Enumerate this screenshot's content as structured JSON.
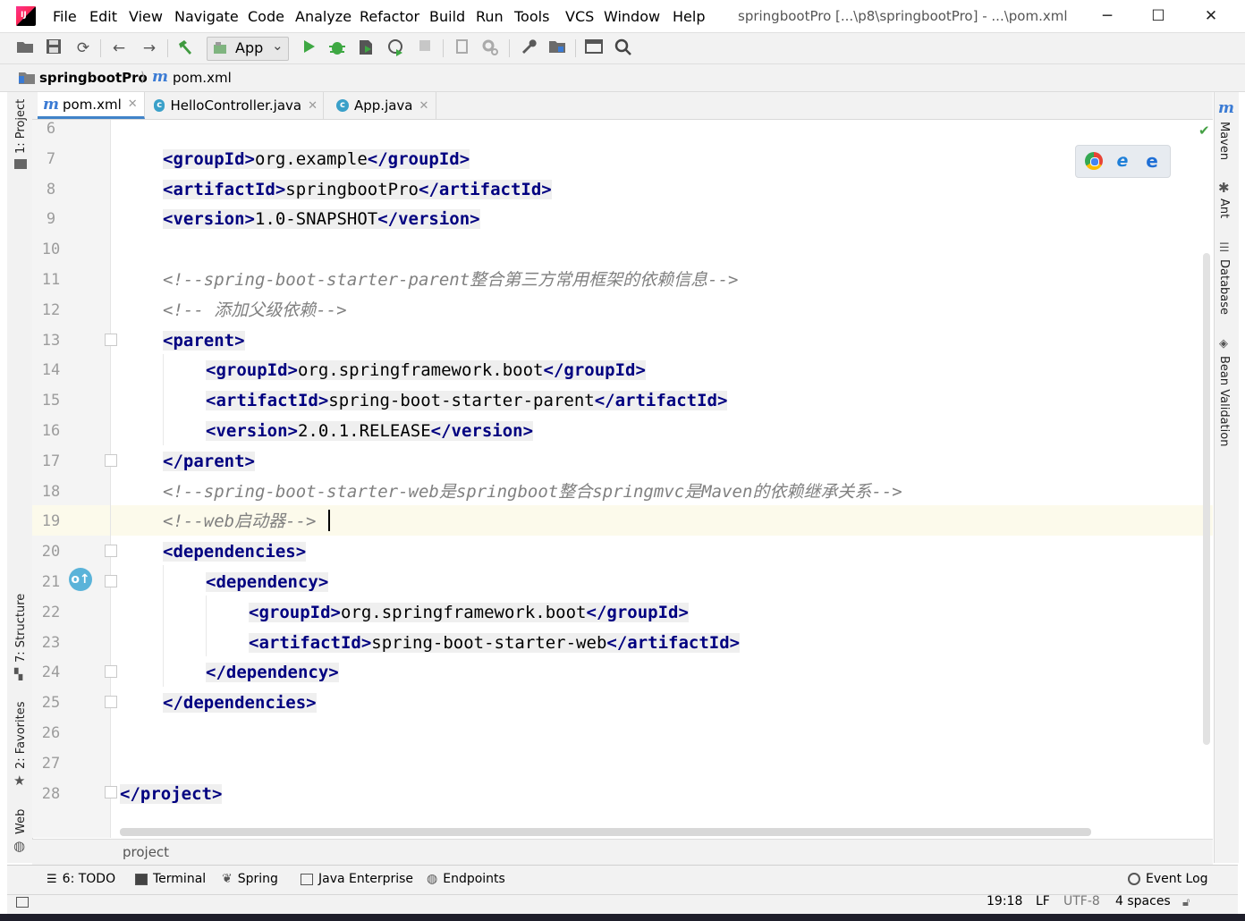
{
  "menu": [
    "File",
    "Edit",
    "View",
    "Navigate",
    "Code",
    "Analyze",
    "Refactor",
    "Build",
    "Run",
    "Tools",
    "VCS",
    "Window",
    "Help"
  ],
  "window_title": "springbootPro [...\\p8\\springbootPro] - ...\\pom.xml",
  "window_controls": {
    "minimize": "─",
    "maximize": "☐",
    "close": "✕"
  },
  "toolbar": {
    "run_config": "App",
    "run_config_arrow": "⌄"
  },
  "breadcrumb": {
    "project": "springbootPro",
    "sep": "⟩",
    "file": "pom.xml"
  },
  "tabs": [
    {
      "label": "pom.xml",
      "icon": "maven-file-icon"
    },
    {
      "label": "HelloController.java",
      "icon": "class-icon"
    },
    {
      "label": "App.java",
      "icon": "class-icon"
    }
  ],
  "left_tools": {
    "project": "1: Project",
    "structure": "7: Structure",
    "favorites": "2: Favorites",
    "web": "Web"
  },
  "right_tools": {
    "maven": "Maven",
    "ant": "Ant",
    "database": "Database",
    "bean_validation": "Bean Validation"
  },
  "editor": {
    "lines": [
      {
        "n": "6"
      },
      {
        "n": "7",
        "parts": [
          [
            "tg",
            "<groupId>"
          ],
          [
            "br",
            "org.example"
          ],
          [
            "tg",
            "</groupId>"
          ]
        ]
      },
      {
        "n": "8",
        "parts": [
          [
            "tg",
            "<artifactId>"
          ],
          [
            "br",
            "springbootPro"
          ],
          [
            "tg",
            "</artifactId>"
          ]
        ]
      },
      {
        "n": "9",
        "parts": [
          [
            "tg",
            "<version>"
          ],
          [
            "br",
            "1.0-SNAPSHOT"
          ],
          [
            "tg",
            "</version>"
          ]
        ]
      },
      {
        "n": "10"
      },
      {
        "n": "11",
        "comment": "<!--spring-boot-starter-parent整合第三方常用框架的依赖信息-->"
      },
      {
        "n": "12",
        "comment": "<!-- 添加父级依赖-->"
      },
      {
        "n": "13",
        "parts": [
          [
            "tg",
            "<parent>"
          ]
        ]
      },
      {
        "n": "14",
        "parts": [
          [
            "tg",
            "<groupId>"
          ],
          [
            "br",
            "org.springframework.boot"
          ],
          [
            "tg",
            "</groupId>"
          ]
        ]
      },
      {
        "n": "15",
        "parts": [
          [
            "tg",
            "<artifactId>"
          ],
          [
            "br",
            "spring-boot-starter-parent"
          ],
          [
            "tg",
            "</artifactId>"
          ]
        ]
      },
      {
        "n": "16",
        "parts": [
          [
            "tg",
            "<version>"
          ],
          [
            "br",
            "2.0.1.RELEASE"
          ],
          [
            "tg",
            "</version>"
          ]
        ]
      },
      {
        "n": "17",
        "parts": [
          [
            "tg",
            "</parent>"
          ]
        ]
      },
      {
        "n": "18",
        "comment": "<!--spring-boot-starter-web是springboot整合springmvc是Maven的依赖继承关系-->"
      },
      {
        "n": "19",
        "comment": "<!--web启动器-->"
      },
      {
        "n": "20",
        "parts": [
          [
            "tg",
            "<dependencies>"
          ]
        ]
      },
      {
        "n": "21",
        "parts": [
          [
            "tg",
            "<dependency>"
          ]
        ]
      },
      {
        "n": "22",
        "parts": [
          [
            "tg",
            "<groupId>"
          ],
          [
            "br",
            "org.springframework.boot"
          ],
          [
            "tg",
            "</groupId>"
          ]
        ]
      },
      {
        "n": "23",
        "parts": [
          [
            "tg",
            "<artifactId>"
          ],
          [
            "br",
            "spring-boot-starter-web"
          ],
          [
            "tg",
            "</artifactId>"
          ]
        ]
      },
      {
        "n": "24",
        "parts": [
          [
            "tg",
            "</dependency>"
          ]
        ]
      },
      {
        "n": "25",
        "parts": [
          [
            "tg",
            "</dependencies>"
          ]
        ]
      },
      {
        "n": "26"
      },
      {
        "n": "27"
      },
      {
        "n": "28",
        "parts": [
          [
            "tg",
            "</project>"
          ]
        ]
      }
    ]
  },
  "tag_breadcrumb": "project",
  "bottom_tools": [
    "6: TODO",
    "Terminal",
    "Spring",
    "Java Enterprise",
    "Endpoints"
  ],
  "event_log": "Event Log",
  "status": {
    "position": "19:18",
    "line_sep": "LF",
    "encoding": "UTF-8",
    "indent": "4 spaces"
  },
  "colors": {
    "tag": "#000080",
    "comment": "#808080",
    "current_line": "#fcfaeb",
    "accent": "#4083c9"
  }
}
